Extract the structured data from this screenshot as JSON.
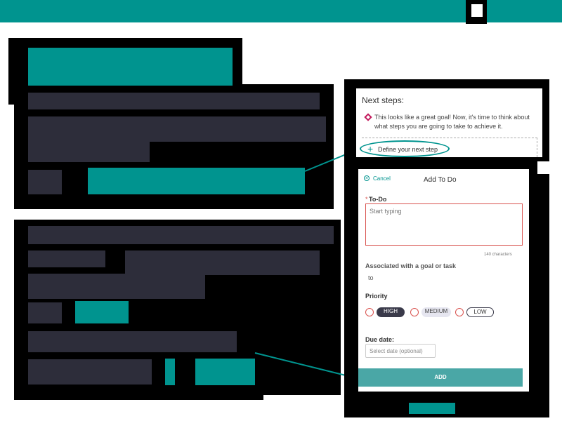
{
  "next_steps": {
    "title": "Next steps:",
    "message": "This looks like a great goal! Now, it's time to think about what steps you are going to take to achieve it.",
    "define_link": "Define your next step"
  },
  "add_todo": {
    "cancel": "Cancel",
    "title": "Add To Do",
    "todo_label": "To-Do",
    "todo_placeholder": "Start typing",
    "char_count": "140 characters",
    "assoc_label": "Associated with a goal or task",
    "assoc_value": "to",
    "priority_label": "Priority",
    "priorities": [
      "HIGH",
      "MEDIUM",
      "LOW"
    ],
    "due_label": "Due date:",
    "due_placeholder": "Select date (optional)",
    "add_button": "ADD"
  },
  "colors": {
    "teal": "#00948f",
    "dark": "#2d2d3a",
    "required_red": "#d9534f"
  }
}
